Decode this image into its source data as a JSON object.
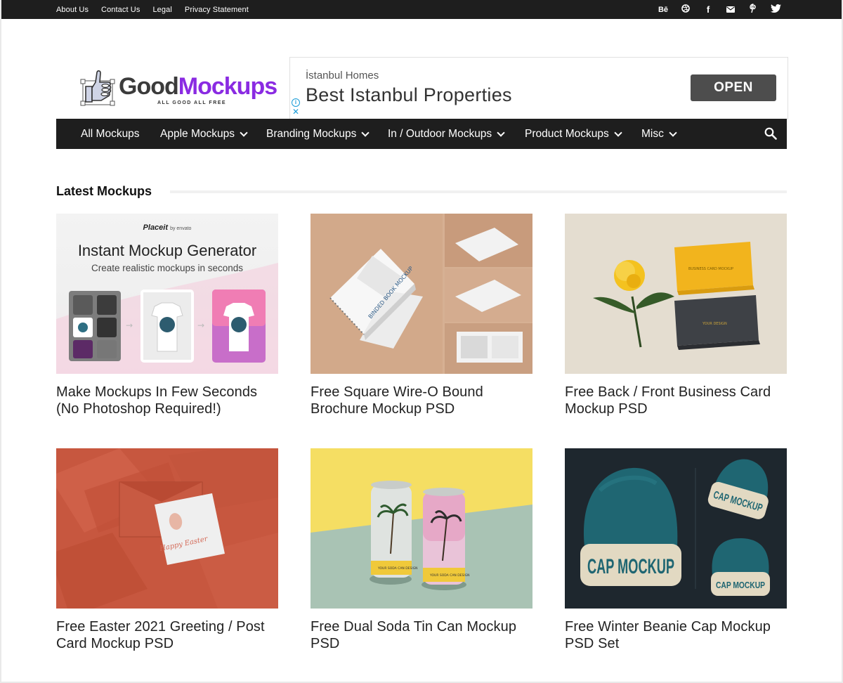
{
  "top_links": [
    "About Us",
    "Contact Us",
    "Legal",
    "Privacy Statement"
  ],
  "social_icons": [
    "behance-icon",
    "dribbble-icon",
    "facebook-icon",
    "mail-icon",
    "pinterest-icon",
    "twitter-icon"
  ],
  "logo": {
    "word_a": "Good",
    "word_b": "Mockups",
    "tagline": "ALL GOOD ALL FREE"
  },
  "ad": {
    "brand": "İstanbul Homes",
    "headline": "Best Istanbul Properties",
    "button": "OPEN",
    "info": "i",
    "close": "✕"
  },
  "nav": {
    "items": [
      {
        "label": "All Mockups",
        "dropdown": false
      },
      {
        "label": "Apple Mockups",
        "dropdown": true
      },
      {
        "label": "Branding Mockups",
        "dropdown": true
      },
      {
        "label": "In / Outdoor Mockups",
        "dropdown": true
      },
      {
        "label": "Product Mockups",
        "dropdown": true
      },
      {
        "label": "Misc",
        "dropdown": true
      }
    ]
  },
  "section": {
    "title": "Latest Mockups"
  },
  "posts": [
    {
      "title": "Make Mockups In Few Seconds (No Photoshop Required!)"
    },
    {
      "title": "Free Square Wire-O Bound Brochure Mockup PSD"
    },
    {
      "title": "Free Back / Front Business Card Mockup PSD"
    },
    {
      "title": "Free Easter 2021 Greeting / Post Card Mockup PSD"
    },
    {
      "title": "Free Dual Soda Tin Can Mockup PSD"
    },
    {
      "title": "Free Winter Beanie Cap Mockup PSD Set"
    }
  ],
  "thumb_text": {
    "placeit_brand": "Placeit",
    "placeit_by": "by envato",
    "placeit_title": "Instant Mockup Generator",
    "placeit_sub": "Create realistic mockups in seconds",
    "brochure_label": "BINDED BOOK MOCKUP",
    "card_label": "BUSINESS CARD MOCKUP",
    "card_label_dark": "YOUR DESIGN",
    "easter_label": "Happy Easter",
    "can_label": "YOUR SODA CAN DESIGN",
    "cap_label": "CAP MOCKUP"
  }
}
